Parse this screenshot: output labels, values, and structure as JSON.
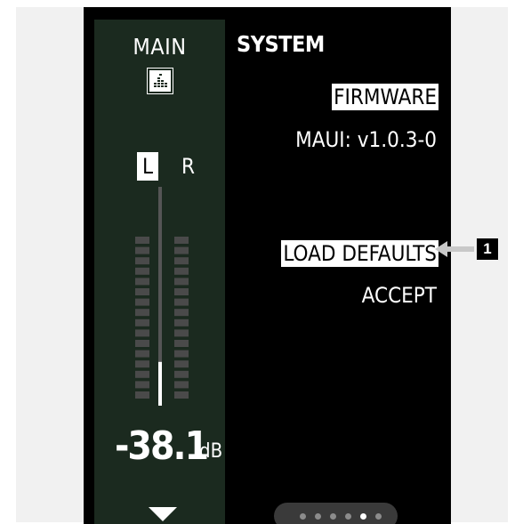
{
  "channel": {
    "title": "MAIN",
    "icon": "eq-bars-icon",
    "left_label": "L",
    "right_label": "R",
    "level_value": "-38.1",
    "level_unit": "dB",
    "meter_segments": 16,
    "fader_level_fraction": 0.2
  },
  "panel": {
    "title": "SYSTEM",
    "firmware_label": "FIRMWARE",
    "firmware_version": "MAUI: v1.0.3-0",
    "load_defaults_label": "LOAD DEFAULTS",
    "accept_label": "ACCEPT"
  },
  "pagination": {
    "total": 6,
    "active_index": 4
  },
  "callout": {
    "number": "1"
  },
  "colors": {
    "device_bg": "#000000",
    "channel_bg": "#1b2a1f",
    "meter_segment": "#4a4a4a",
    "highlight": "#ffffff",
    "callout_arrow": "#c8c8c8"
  }
}
